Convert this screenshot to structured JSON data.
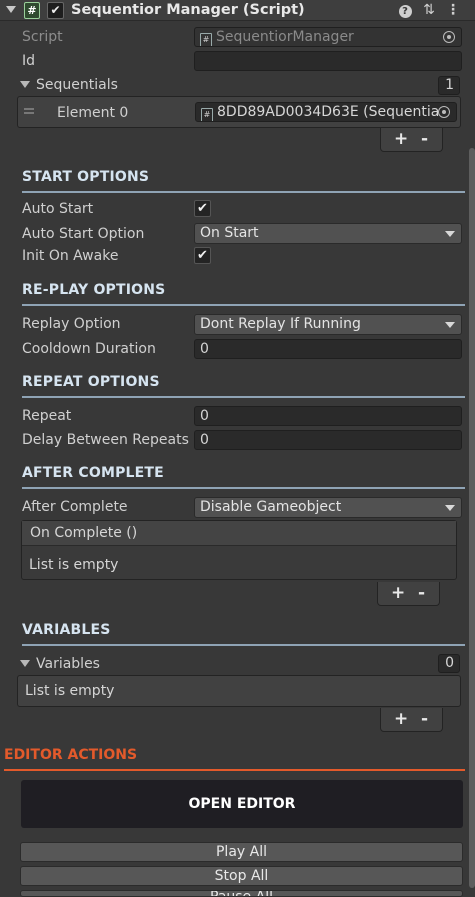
{
  "header": {
    "title": "Sequentior Manager (Script)",
    "script_icon": "#",
    "enabled_check": "✔",
    "help_icon": "?",
    "settings_icon": "⇅",
    "menu_icon": "⋮"
  },
  "fields": {
    "script_label": "Script",
    "script_value": "SequentiorManager",
    "id_label": "Id",
    "id_value": "",
    "sequentials_label": "Sequentials",
    "sequentials_count": "1",
    "element0_label": "Element 0",
    "element0_value": "8DD89AD0034D63E (Sequentia"
  },
  "start_options": {
    "title": "START OPTIONS",
    "auto_start_label": "Auto Start",
    "auto_start_checked": "✔",
    "auto_start_option_label": "Auto Start Option",
    "auto_start_option_value": "On Start",
    "init_on_awake_label": "Init On Awake",
    "init_on_awake_checked": "✔"
  },
  "replay_options": {
    "title": "RE-PLAY OPTIONS",
    "replay_option_label": "Replay Option",
    "replay_option_value": "Dont Replay If Running",
    "cooldown_label": "Cooldown Duration",
    "cooldown_value": "0"
  },
  "repeat_options": {
    "title": "REPEAT OPTIONS",
    "repeat_label": "Repeat",
    "repeat_value": "0",
    "delay_label": "Delay Between Repeats",
    "delay_value": "0"
  },
  "after_complete": {
    "title": "AFTER COMPLETE",
    "after_complete_label": "After Complete",
    "after_complete_value": "Disable Gameobject",
    "event_header": "On Complete ()",
    "event_empty": "List is empty"
  },
  "variables": {
    "title": "VARIABLES",
    "variables_label": "Variables",
    "variables_count": "0",
    "empty_text": "List is empty"
  },
  "list_controls": {
    "plus": "+",
    "minus": "-"
  },
  "editor_actions": {
    "title": "EDITOR ACTIONS",
    "open_editor": "OPEN EDITOR",
    "play_all": "Play All",
    "stop_all": "Stop All",
    "pause_all": "Pause All"
  },
  "colors": {
    "background": "#383838",
    "section_title": "#d6e4f0",
    "editor_accent": "#e35a2b",
    "open_editor_bg": "#1f1e23"
  }
}
